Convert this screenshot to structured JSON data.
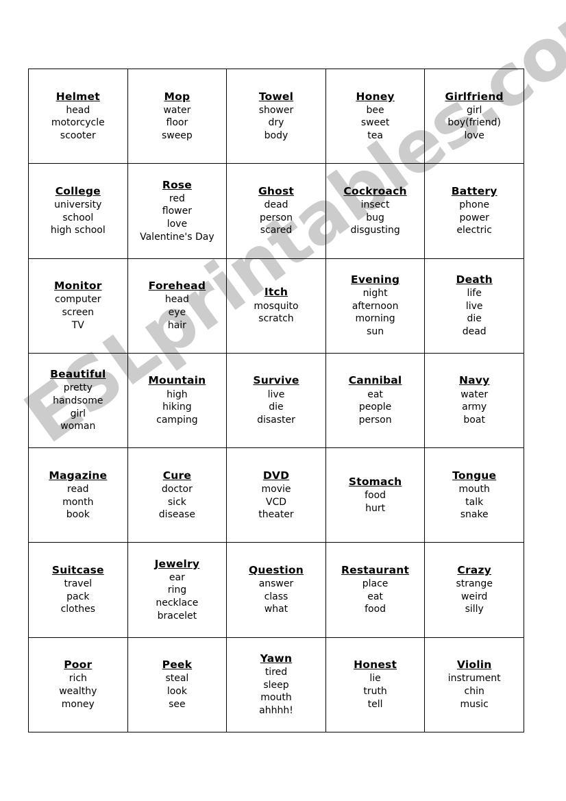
{
  "document": {
    "title": "Vocabulary Taboo Cards Worksheet",
    "background_color": "#ffffff",
    "text_color": "#000000",
    "border_color": "#000000"
  },
  "watermark": {
    "text": "ESLprintables.com",
    "color": "#cccccc",
    "rotation_degrees": -36
  },
  "grid": {
    "columns": 5,
    "rows": 7,
    "cards": [
      {
        "title": "Helmet",
        "clues": [
          "head",
          "motorcycle",
          "scooter"
        ]
      },
      {
        "title": "Mop",
        "clues": [
          "water",
          "floor",
          "sweep"
        ]
      },
      {
        "title": "Towel",
        "clues": [
          "shower",
          "dry",
          "body"
        ]
      },
      {
        "title": "Honey",
        "clues": [
          "bee",
          "sweet",
          "tea"
        ]
      },
      {
        "title": "Girlfriend",
        "clues": [
          "girl",
          "boy(friend)",
          "love"
        ]
      },
      {
        "title": "College",
        "clues": [
          "university",
          "school",
          "high school"
        ]
      },
      {
        "title": "Rose",
        "clues": [
          "red",
          "flower",
          "love",
          "Valentine's Day"
        ]
      },
      {
        "title": "Ghost",
        "clues": [
          "dead",
          "person",
          "scared"
        ]
      },
      {
        "title": "Cockroach",
        "clues": [
          "insect",
          "bug",
          "disgusting"
        ]
      },
      {
        "title": "Battery",
        "clues": [
          "phone",
          "power",
          "electric"
        ]
      },
      {
        "title": "Monitor",
        "clues": [
          "computer",
          "screen",
          "TV"
        ]
      },
      {
        "title": "Forehead",
        "clues": [
          "head",
          "eye",
          "hair"
        ]
      },
      {
        "title": "Itch",
        "clues": [
          "mosquito",
          "scratch"
        ]
      },
      {
        "title": "Evening",
        "clues": [
          "night",
          "afternoon",
          "morning",
          "sun"
        ]
      },
      {
        "title": "Death",
        "clues": [
          "life",
          "live",
          "die",
          "dead"
        ]
      },
      {
        "title": "Beautiful",
        "clues": [
          "pretty",
          "handsome",
          "girl",
          "woman"
        ]
      },
      {
        "title": "Mountain",
        "clues": [
          "high",
          "hiking",
          "camping"
        ]
      },
      {
        "title": "Survive",
        "clues": [
          "live",
          "die",
          "disaster"
        ]
      },
      {
        "title": "Cannibal",
        "clues": [
          "eat",
          "people",
          "person"
        ]
      },
      {
        "title": "Navy",
        "clues": [
          "water",
          "army",
          "boat"
        ]
      },
      {
        "title": "Magazine",
        "clues": [
          "read",
          "month",
          "book"
        ]
      },
      {
        "title": "Cure",
        "clues": [
          "doctor",
          "sick",
          "disease"
        ]
      },
      {
        "title": "DVD",
        "clues": [
          "movie",
          "VCD",
          "theater"
        ]
      },
      {
        "title": "Stomach",
        "clues": [
          "food",
          "hurt"
        ]
      },
      {
        "title": "Tongue",
        "clues": [
          "mouth",
          "talk",
          "snake"
        ]
      },
      {
        "title": "Suitcase",
        "clues": [
          "travel",
          "pack",
          "clothes"
        ]
      },
      {
        "title": "Jewelry",
        "clues": [
          "ear",
          "ring",
          "necklace",
          "bracelet"
        ]
      },
      {
        "title": "Question",
        "clues": [
          "answer",
          "class",
          "what"
        ]
      },
      {
        "title": "Restaurant",
        "clues": [
          "place",
          "eat",
          "food"
        ]
      },
      {
        "title": "Crazy",
        "clues": [
          "strange",
          "weird",
          "silly"
        ]
      },
      {
        "title": "Poor",
        "clues": [
          "rich",
          "wealthy",
          "money"
        ]
      },
      {
        "title": "Peek",
        "clues": [
          "steal",
          "look",
          "see"
        ]
      },
      {
        "title": "Yawn",
        "clues": [
          "tired",
          "sleep",
          "mouth",
          "ahhhh!"
        ]
      },
      {
        "title": "Honest",
        "clues": [
          "lie",
          "truth",
          "tell"
        ]
      },
      {
        "title": "Violin",
        "clues": [
          "instrument",
          "chin",
          "music"
        ]
      }
    ]
  }
}
